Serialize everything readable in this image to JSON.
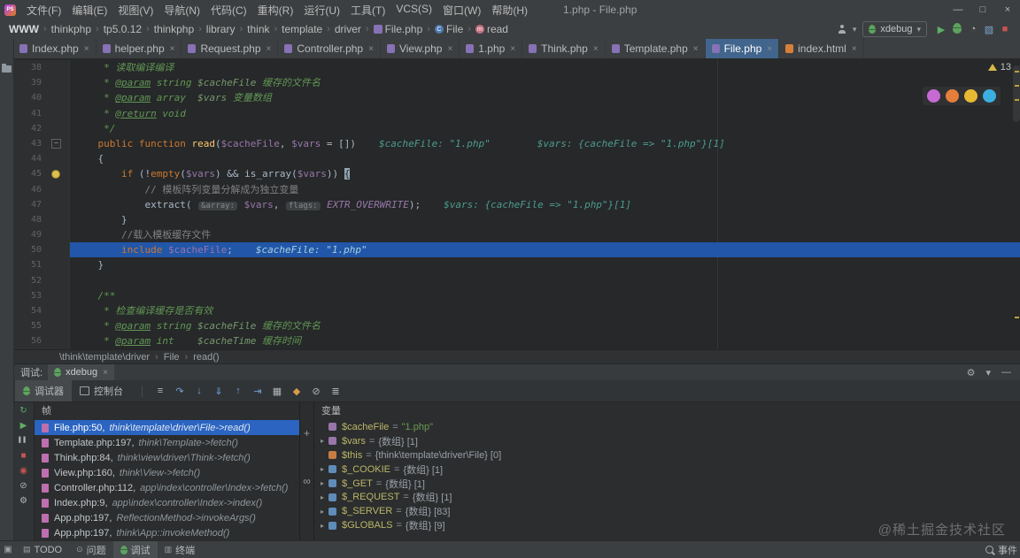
{
  "window": {
    "title": "1.php - File.php",
    "logo": "PS",
    "controls": {
      "minimize": "—",
      "maximize": "□",
      "close": "×"
    }
  },
  "ui": {
    "close_glyph": "×",
    "chevron_down": "▾",
    "crumb_sep": "›",
    "expand_arrow": "▸",
    "fold_glyph": "−",
    "corner_glyph": "▣"
  },
  "menu_bar": {
    "items": [
      "文件(F)",
      "编辑(E)",
      "视图(V)",
      "导航(N)",
      "代码(C)",
      "重构(R)",
      "运行(U)",
      "工具(T)",
      "VCS(S)",
      "窗口(W)",
      "帮助(H)"
    ]
  },
  "nav_bar": {
    "breadcrumbs": [
      {
        "label": "WWW"
      },
      {
        "label": "thinkphp"
      },
      {
        "label": "tp5.0.12"
      },
      {
        "label": "thinkphp"
      },
      {
        "label": "library"
      },
      {
        "label": "think"
      },
      {
        "label": "template"
      },
      {
        "label": "driver"
      },
      {
        "label": "File.php",
        "icon": "php-file"
      },
      {
        "label": "File",
        "icon": "class"
      },
      {
        "label": "read",
        "icon": "method"
      }
    ],
    "run_config": {
      "label": "xdebug"
    },
    "actions": [
      {
        "name": "run",
        "glyph": "▶",
        "color": "#5fad65"
      },
      {
        "name": "debug",
        "glyph": "bug"
      },
      {
        "name": "coverage",
        "glyph": "◔",
        "color": "#b3b6b8"
      },
      {
        "name": "profiler",
        "glyph": "▧",
        "color": "#7ba7d0"
      },
      {
        "name": "stop",
        "glyph": "■",
        "color": "#c75450"
      }
    ]
  },
  "editor_tabs": [
    {
      "label": "Index.php",
      "kind": "php"
    },
    {
      "label": "helper.php",
      "kind": "php"
    },
    {
      "label": "Request.php",
      "kind": "php"
    },
    {
      "label": "Controller.php",
      "kind": "php"
    },
    {
      "label": "View.php",
      "kind": "php"
    },
    {
      "label": "1.php",
      "kind": "php"
    },
    {
      "label": "Think.php",
      "kind": "php"
    },
    {
      "label": "Template.php",
      "kind": "php"
    },
    {
      "label": "File.php",
      "kind": "php",
      "active": true
    },
    {
      "label": "index.html",
      "kind": "html"
    }
  ],
  "editor": {
    "inspection_count": "13",
    "browser_icons": [
      {
        "name": "opera",
        "color": "#c76ad4"
      },
      {
        "name": "firefox",
        "color": "#e57e3a"
      },
      {
        "name": "chrome",
        "color": "#e8b832"
      },
      {
        "name": "edge",
        "color": "#3bb0e0"
      }
    ],
    "lines": [
      {
        "n": 38,
        "segs": [
          [
            "doc",
            "     * 读取编译编译"
          ]
        ]
      },
      {
        "n": 39,
        "segs": [
          [
            "doc",
            "     * "
          ],
          [
            "doctag",
            "@param"
          ],
          [
            "doc",
            " string "
          ],
          [
            "docvar",
            "$cacheFile"
          ],
          [
            "doc",
            " 缓存的文件名"
          ]
        ]
      },
      {
        "n": 40,
        "segs": [
          [
            "doc",
            "     * "
          ],
          [
            "doctag",
            "@param"
          ],
          [
            "doc",
            " array  "
          ],
          [
            "docvar",
            "$vars"
          ],
          [
            "doc",
            " 变量数组"
          ]
        ]
      },
      {
        "n": 41,
        "segs": [
          [
            "doc",
            "     * "
          ],
          [
            "doctag",
            "@return"
          ],
          [
            "doc",
            " void"
          ]
        ]
      },
      {
        "n": 42,
        "segs": [
          [
            "doc",
            "     */"
          ]
        ]
      },
      {
        "n": 43,
        "fold": true,
        "segs": [
          [
            "pl",
            "    "
          ],
          [
            "kw",
            "public"
          ],
          [
            "pl",
            " "
          ],
          [
            "kw",
            "function"
          ],
          [
            "pl",
            " "
          ],
          [
            "fn",
            "read"
          ],
          [
            "pl",
            "("
          ],
          [
            "var",
            "$cacheFile"
          ],
          [
            "pl",
            ", "
          ],
          [
            "var",
            "$vars"
          ],
          [
            "pl",
            " = [])"
          ]
        ],
        "hint": "$cacheFile: \"1.php\"        $vars: {cacheFile => \"1.php\"}[1]"
      },
      {
        "n": 44,
        "segs": [
          [
            "pl",
            "    {"
          ]
        ]
      },
      {
        "n": 45,
        "bulb": true,
        "segs": [
          [
            "pl",
            "        "
          ],
          [
            "kw",
            "if"
          ],
          [
            "pl",
            " (!"
          ],
          [
            "kw",
            "empty"
          ],
          [
            "pl",
            "("
          ],
          [
            "var",
            "$vars"
          ],
          [
            "pl",
            ") && is_array("
          ],
          [
            "var",
            "$vars"
          ],
          [
            "pl",
            ")) "
          ],
          [
            "brace",
            "{"
          ]
        ]
      },
      {
        "n": 46,
        "segs": [
          [
            "cmt",
            "            // 模板阵列变量分解成为独立变量"
          ]
        ]
      },
      {
        "n": 47,
        "segs": [
          [
            "pl",
            "            extract( "
          ],
          [
            "inlay",
            "&array:"
          ],
          [
            "pl",
            " "
          ],
          [
            "var",
            "$vars"
          ],
          [
            "pl",
            ", "
          ],
          [
            "inlay",
            "flags:"
          ],
          [
            "pl",
            " "
          ],
          [
            "const",
            "EXTR_OVERWRITE"
          ],
          [
            "pl",
            ");"
          ]
        ],
        "hint": "$vars: {cacheFile => \"1.php\"}[1]"
      },
      {
        "n": 48,
        "segs": [
          [
            "pl",
            "        }"
          ]
        ]
      },
      {
        "n": 49,
        "segs": [
          [
            "cmt",
            "        //载入模板缓存文件"
          ]
        ]
      },
      {
        "n": 50,
        "exec": true,
        "segs": [
          [
            "pl",
            "        "
          ],
          [
            "kw",
            "include"
          ],
          [
            "pl",
            " "
          ],
          [
            "var",
            "$cacheFile"
          ],
          [
            "pl",
            ";"
          ]
        ],
        "hint": "$cacheFile: \"1.php\""
      },
      {
        "n": 51,
        "segs": [
          [
            "pl",
            "    }"
          ]
        ]
      },
      {
        "n": 52,
        "segs": []
      },
      {
        "n": 53,
        "segs": [
          [
            "doc",
            "    /**"
          ]
        ]
      },
      {
        "n": 54,
        "segs": [
          [
            "doc",
            "     * 检查编译缓存是否有效"
          ]
        ]
      },
      {
        "n": 55,
        "segs": [
          [
            "doc",
            "     * "
          ],
          [
            "doctag",
            "@param"
          ],
          [
            "doc",
            " string "
          ],
          [
            "docvar",
            "$cacheFile"
          ],
          [
            "doc",
            " 缓存的文件名"
          ]
        ]
      },
      {
        "n": 56,
        "segs": [
          [
            "doc",
            "     * "
          ],
          [
            "doctag",
            "@param"
          ],
          [
            "doc",
            " int    "
          ],
          [
            "docvar",
            "$cacheTime"
          ],
          [
            "doc",
            " 缓存时间"
          ]
        ]
      }
    ],
    "breadcrumb": [
      "\\think\\template\\driver",
      "File",
      "read()"
    ]
  },
  "debugger": {
    "window_title": "调试:",
    "session_tab": "xdebug",
    "header_icons": [
      {
        "name": "settings",
        "glyph": "⚙"
      },
      {
        "name": "collapse",
        "glyph": "▾"
      },
      {
        "name": "hide",
        "glyph": "—"
      }
    ],
    "tabs": [
      {
        "label": "调试器",
        "icon": "debugger",
        "active": true
      },
      {
        "label": "控制台",
        "icon": "console"
      }
    ],
    "step_icons": [
      {
        "name": "show-execution-point",
        "glyph": "≡",
        "color": "#b3b6b8"
      },
      {
        "name": "step-over",
        "glyph": "↷",
        "color": "#72a1d8"
      },
      {
        "name": "step-into",
        "glyph": "↓",
        "color": "#72a1d8"
      },
      {
        "name": "force-step-into",
        "glyph": "⇓",
        "color": "#72a1d8"
      },
      {
        "name": "step-out",
        "glyph": "↑",
        "color": "#72a1d8"
      },
      {
        "name": "run-to-cursor",
        "glyph": "⇥",
        "color": "#72a1d8"
      },
      {
        "name": "evaluate-expression",
        "glyph": "▦",
        "color": "#b3b6b8"
      },
      {
        "name": "view-breakpoints",
        "glyph": "◆",
        "color": "#d89b4a"
      },
      {
        "name": "mute-breakpoints",
        "glyph": "⊘",
        "color": "#b3b6b8"
      },
      {
        "name": "layout-settings",
        "glyph": "≣",
        "color": "#b3b6b8"
      }
    ],
    "left_icons": [
      {
        "name": "rerun",
        "glyph": "↻",
        "color": "#5fad65"
      },
      {
        "name": "resume",
        "glyph": "▶",
        "color": "#5fad65"
      },
      {
        "name": "pause",
        "glyph": "▌▌",
        "color": "#b3b6b8",
        "pause": true
      },
      {
        "name": "stop",
        "glyph": "■",
        "color": "#c75450"
      },
      {
        "name": "view-breakpoints",
        "glyph": "◉",
        "color": "#c75450"
      },
      {
        "name": "mute-breakpoints",
        "glyph": "⊘",
        "color": "#b3b6b8"
      },
      {
        "name": "settings",
        "glyph": "⚙",
        "color": "#b3b6b8"
      }
    ],
    "frames_title": "帧",
    "frames": [
      {
        "location": "File.php:50,",
        "method": "think\\template\\driver\\File->read()",
        "selected": true
      },
      {
        "location": "Template.php:197,",
        "method": "think\\Template->fetch()"
      },
      {
        "location": "Think.php:84,",
        "method": "think\\view\\driver\\Think->fetch()"
      },
      {
        "location": "View.php:160,",
        "method": "think\\View->fetch()"
      },
      {
        "location": "Controller.php:112,",
        "method": "app\\index\\controller\\Index->fetch()"
      },
      {
        "location": "Index.php:9,",
        "method": "app\\index\\controller\\Index->index()"
      },
      {
        "location": "App.php:197,",
        "method": "ReflectionMethod->invokeArgs()"
      },
      {
        "location": "App.php:197,",
        "method": "think\\App::invokeMethod()"
      }
    ],
    "strip_icons": [
      {
        "name": "add-watch",
        "glyph": "+"
      },
      {
        "name": "show-values-inline",
        "glyph": "∞"
      }
    ],
    "variables_title": "变量",
    "variables": [
      {
        "name": "$cacheFile",
        "value": "\"1.php\"",
        "vclass": "str",
        "icon": "var",
        "expandable": false
      },
      {
        "name": "$vars",
        "value": "{数组} [1]",
        "vclass": "obj",
        "icon": "var",
        "expandable": true
      },
      {
        "name": "$this",
        "value": "{think\\template\\driver\\File} [0]",
        "vclass": "obj",
        "icon": "this",
        "expandable": false
      },
      {
        "name": "$_COOKIE",
        "value": "{数组} [1]",
        "vclass": "obj",
        "icon": "global",
        "expandable": true
      },
      {
        "name": "$_GET",
        "value": "{数组} [1]",
        "vclass": "obj",
        "icon": "global",
        "expandable": true
      },
      {
        "name": "$_REQUEST",
        "value": "{数组} [1]",
        "vclass": "obj",
        "icon": "global",
        "expandable": true
      },
      {
        "name": "$_SERVER",
        "value": "{数组} [83]",
        "vclass": "obj",
        "icon": "global",
        "expandable": true
      },
      {
        "name": "$GLOBALS",
        "value": "{数组} [9]",
        "vclass": "obj",
        "icon": "global",
        "expandable": true
      }
    ]
  },
  "status_bar": {
    "corner_glyph": "▣",
    "items": [
      {
        "label": "TODO",
        "glyph": "▤"
      },
      {
        "label": "问题",
        "glyph": "⊙"
      },
      {
        "label": "调试",
        "glyph": "bug",
        "active": true
      },
      {
        "label": "终端",
        "glyph": "▥"
      }
    ],
    "event_log": "事件"
  },
  "watermark": "@稀土掘金技术社区"
}
